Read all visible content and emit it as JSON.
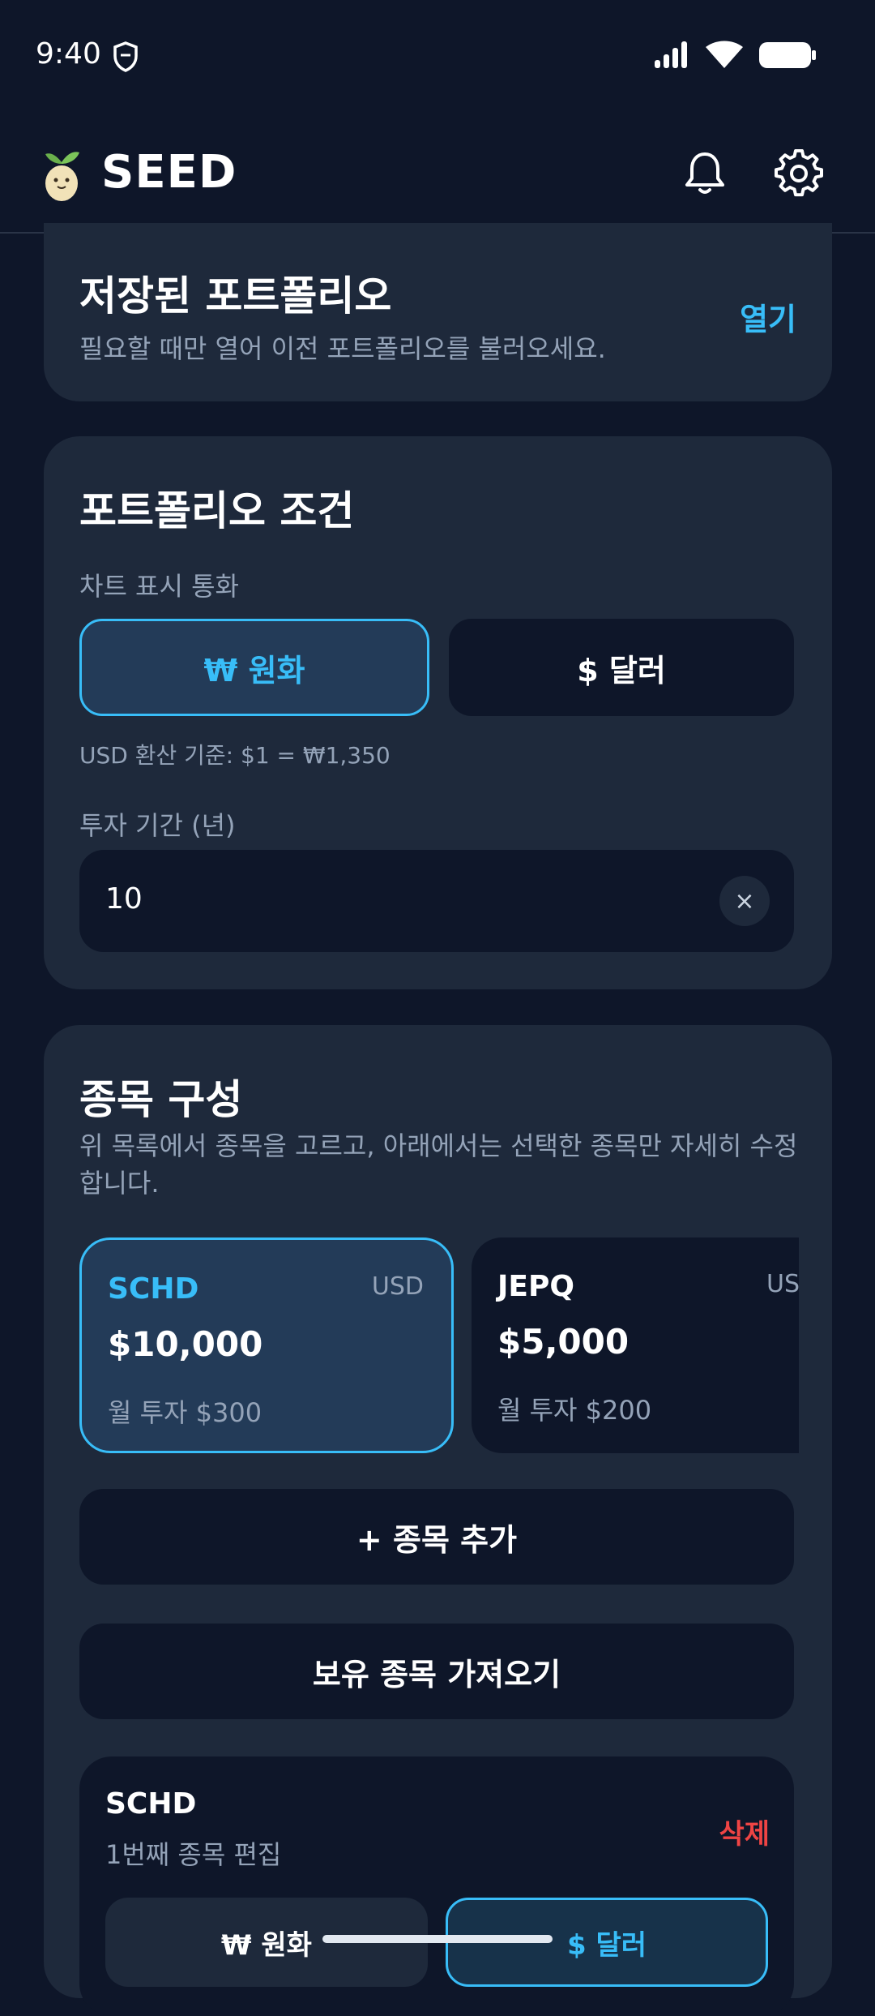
{
  "status_bar": {
    "time": "9:40"
  },
  "header": {
    "app_title": "SEED"
  },
  "saved_portfolio": {
    "title": "저장된 포트폴리오",
    "subtitle": "필요할 때만 열어 이전 포트폴리오를 불러오세요.",
    "open_label": "열기"
  },
  "conditions": {
    "title": "포트폴리오 조건",
    "currency_label": "차트 표시 통화",
    "currency_options": [
      "₩ 원화",
      "$ 달러"
    ],
    "selected_currency": "₩ 원화",
    "rate_note": "USD 환산 기준: $1 = ₩1,350",
    "period_label": "투자 기간 (년)",
    "period_value": "10",
    "clear_symbol": "×"
  },
  "holdings": {
    "title": "종목 구성",
    "description": "위 목록에서 종목을 고르고, 아래에서는 선택한 종목만 자세히 수정합니다.",
    "tiles": [
      {
        "symbol": "SCHD",
        "currency": "USD",
        "amount": "$10,000",
        "monthly": "월 투자 $300",
        "selected": true
      },
      {
        "symbol": "JEPQ",
        "currency": "USD",
        "amount": "$5,000",
        "monthly": "월 투자 $200",
        "selected": false
      }
    ],
    "add_label": "+ 종목 추가",
    "import_label": "보유 종목 가져오기"
  },
  "editor": {
    "symbol": "SCHD",
    "subtitle": "1번째 종목 편집",
    "delete_label": "삭제",
    "currency_options": [
      "₩ 원화",
      "$ 달러"
    ],
    "selected_currency": "$ 달러"
  },
  "colors": {
    "background": "#0e1629",
    "card": "#1e293b",
    "accent": "#38bdf8",
    "danger": "#ef4444",
    "muted_text": "#94a3b8"
  },
  "icons": {
    "status": [
      "shield-icon",
      "signal-icon",
      "wifi-icon",
      "battery-icon"
    ],
    "header": [
      "seed-logo",
      "bell-icon",
      "gear-icon"
    ]
  }
}
